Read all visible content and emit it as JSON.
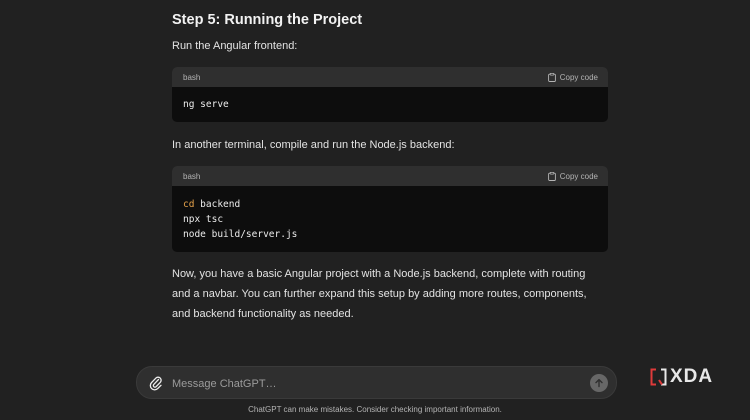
{
  "content": {
    "heading": "Step 5: Running the Project",
    "para1": "Run the Angular frontend:",
    "code1": {
      "lang": "bash",
      "copy_label": "Copy code",
      "line1": "ng serve"
    },
    "para2": "In another terminal, compile and run the Node.js backend:",
    "code2": {
      "lang": "bash",
      "copy_label": "Copy code",
      "line1_kw": "cd",
      "line1_rest": " backend",
      "line2": "npx tsc",
      "line3": "node build/server.js"
    },
    "para3": "Now, you have a basic Angular project with a Node.js backend, complete with routing and a navbar. You can further expand this setup by adding more routes, components, and backend functionality as needed."
  },
  "composer": {
    "placeholder": "Message ChatGPT…"
  },
  "footer": {
    "disclaimer": "ChatGPT can make mistakes. Consider checking important information."
  },
  "watermark": {
    "text": "XDA"
  },
  "icons": {
    "copy": "clipboard-icon",
    "attach": "paperclip-icon",
    "send": "arrow-up-icon",
    "logo": "xda-logo-icon"
  },
  "colors": {
    "background": "#212121",
    "code_bg": "#0d0d0d",
    "code_header": "#2f2f2f",
    "keyword": "#e5a24b"
  }
}
